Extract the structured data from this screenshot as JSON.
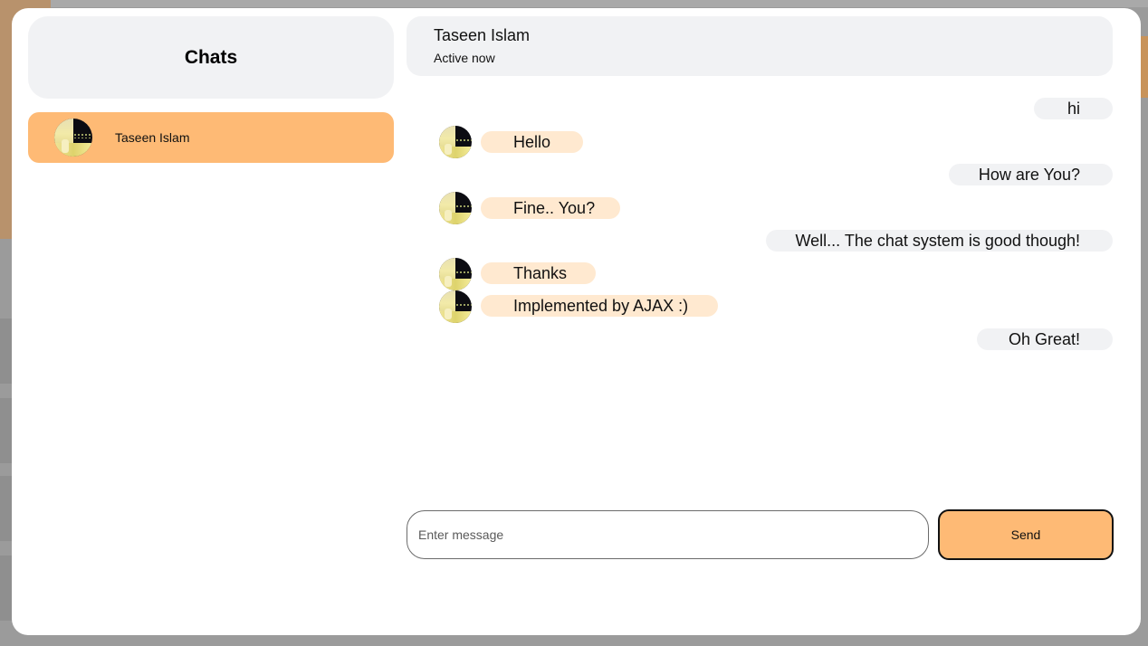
{
  "sidebar": {
    "title": "Chats",
    "contacts": [
      {
        "name": "Taseen Islam"
      }
    ]
  },
  "chat": {
    "contact_name": "Taseen Islam",
    "status": "Active now",
    "messages": [
      {
        "direction": "sent",
        "text": "hi"
      },
      {
        "direction": "received",
        "text": "Hello"
      },
      {
        "direction": "sent",
        "text": "How are You?"
      },
      {
        "direction": "received",
        "text": "Fine.. You?"
      },
      {
        "direction": "sent",
        "text": "Well... The chat system is good though!"
      },
      {
        "direction": "received",
        "text": "Thanks"
      },
      {
        "direction": "received",
        "text": "Implemented by AJAX :)"
      },
      {
        "direction": "sent",
        "text": "Oh Great!"
      }
    ]
  },
  "composer": {
    "placeholder": "Enter message",
    "send_label": "Send"
  },
  "colors": {
    "accent": "#feba75",
    "received_bubble": "#ffe9d0",
    "sent_bubble": "#f1f2f4"
  }
}
